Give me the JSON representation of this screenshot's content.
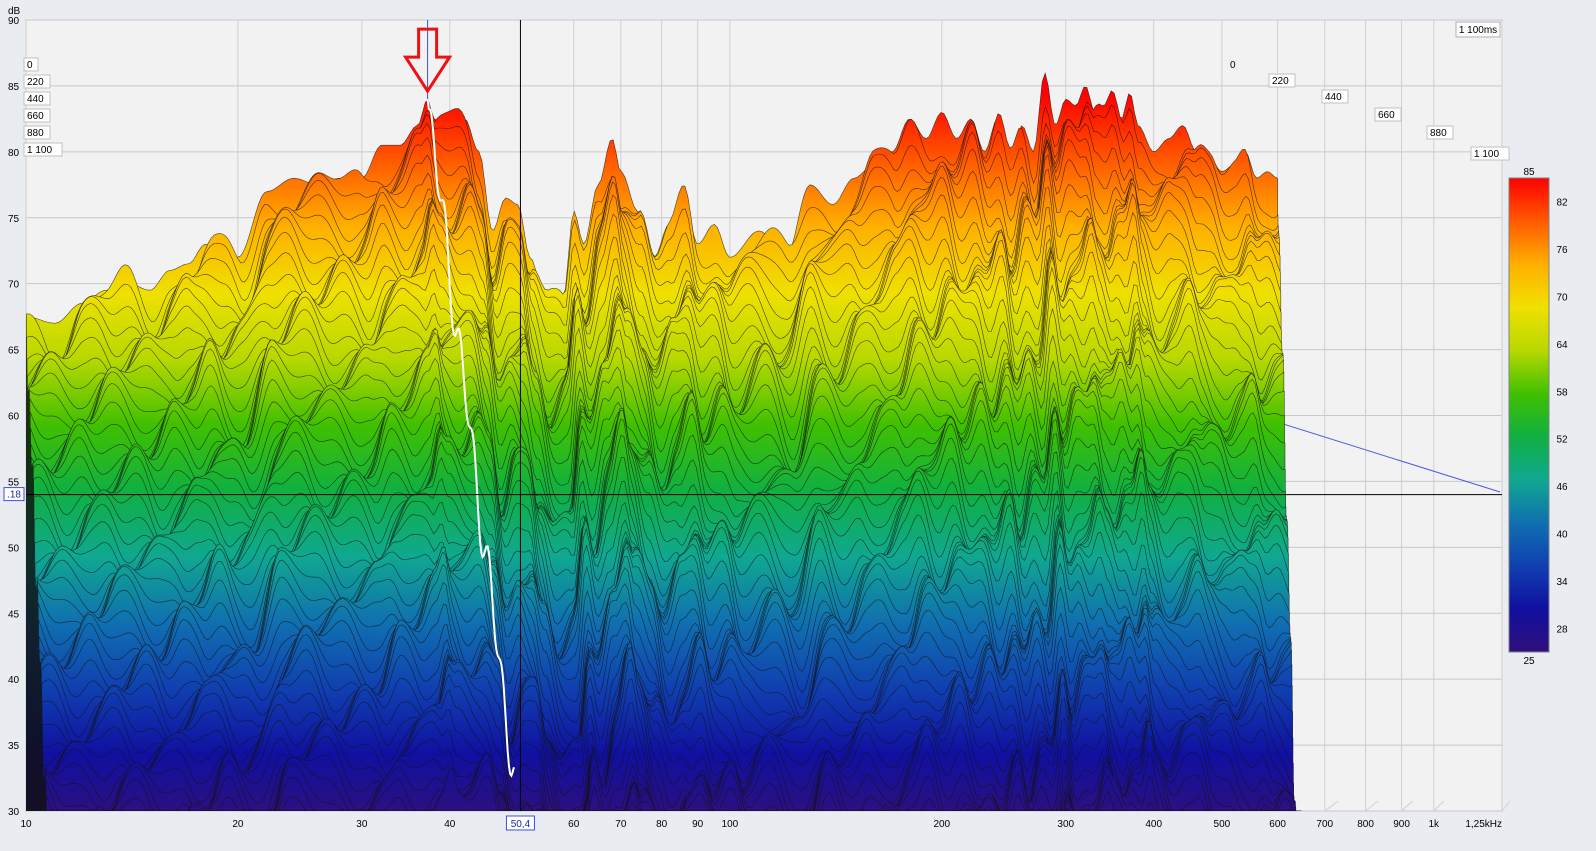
{
  "chart_data": {
    "type": "area",
    "title": "",
    "ylabel": "dB",
    "xlabel": "",
    "x_scale": "log",
    "xlim": [
      10,
      1250
    ],
    "ylim": [
      30,
      90
    ],
    "y_ticks": [
      30,
      35,
      40,
      45,
      50,
      55,
      60,
      65,
      70,
      75,
      80,
      85,
      90
    ],
    "x_ticks": [
      {
        "value": 10,
        "label": "10"
      },
      {
        "value": 20,
        "label": "20"
      },
      {
        "value": 30,
        "label": "30"
      },
      {
        "value": 40,
        "label": "40"
      },
      {
        "value": 60,
        "label": "60"
      },
      {
        "value": 70,
        "label": "70"
      },
      {
        "value": 80,
        "label": "80"
      },
      {
        "value": 90,
        "label": "90"
      },
      {
        "value": 100,
        "label": "100"
      },
      {
        "value": 200,
        "label": "200"
      },
      {
        "value": 300,
        "label": "300"
      },
      {
        "value": 400,
        "label": "400"
      },
      {
        "value": 500,
        "label": "500"
      },
      {
        "value": 600,
        "label": "600"
      },
      {
        "value": 700,
        "label": "700"
      },
      {
        "value": 800,
        "label": "800"
      },
      {
        "value": 900,
        "label": "900"
      },
      {
        "value": 1000,
        "label": "1k"
      },
      {
        "value": 1250,
        "label": "1,25kHz"
      }
    ],
    "time_axis_unit": "ms",
    "time_max_label": "1 100ms",
    "time_ticks_left": [
      "0",
      "220",
      "440",
      "660",
      "880",
      "1 100"
    ],
    "time_ticks_right": [
      "0",
      "220",
      "440",
      "660",
      "880",
      "1 100"
    ],
    "cursor": {
      "freq": 50.4,
      "freq_label": "50,4",
      "level": 54.0,
      "level_label": ".18"
    },
    "peak_marker": {
      "freq": 37.2,
      "level": 84.0
    },
    "colorbar": {
      "min_label": "25",
      "max_label": "85",
      "ticks": [
        "82",
        "76",
        "70",
        "64",
        "58",
        "52",
        "46",
        "40",
        "34",
        "28"
      ],
      "stops": [
        "#ff0000",
        "#ff5a00",
        "#ffb000",
        "#f0e000",
        "#b8d800",
        "#40c000",
        "#10b040",
        "#10a890",
        "#1070b0",
        "#1040b0",
        "#1010a0",
        "#30107a"
      ]
    },
    "series": [
      {
        "x": [
          10,
          11,
          12,
          13,
          14,
          15,
          16,
          17,
          18,
          19,
          20,
          22,
          24,
          26,
          28,
          30,
          32,
          34,
          36,
          37.2,
          38,
          40,
          42,
          44,
          46,
          48,
          50,
          52,
          55,
          58,
          60,
          62,
          65,
          68,
          70,
          74,
          78,
          82,
          86,
          90,
          95,
          100,
          110,
          120,
          130,
          140,
          150,
          160,
          170,
          180,
          190,
          200,
          210,
          220,
          230,
          240,
          250,
          260,
          270,
          280,
          290,
          300,
          310,
          320,
          330,
          340,
          350,
          360,
          370,
          380,
          400,
          420,
          440,
          460,
          480,
          500,
          520,
          540,
          560,
          580,
          600
        ],
        "values": [
          67.5,
          67.0,
          68.5,
          69.5,
          70.0,
          69.5,
          71.0,
          71.5,
          73.0,
          72.0,
          72.0,
          77.0,
          78.0,
          77.5,
          78.0,
          78.0,
          80.5,
          80.5,
          82.0,
          84.0,
          82.5,
          81.5,
          82.5,
          80.0,
          74.0,
          76.5,
          76.0,
          72.0,
          68.0,
          69.0,
          75.5,
          73.0,
          77.5,
          81.0,
          78.5,
          75.5,
          72.0,
          74.5,
          76.5,
          73.0,
          74.5,
          72.0,
          74.0,
          72.0,
          77.5,
          76.0,
          78.0,
          79.0,
          80.0,
          82.5,
          81.0,
          83.0,
          81.0,
          82.5,
          80.0,
          82.5,
          79.0,
          82.0,
          80.0,
          86.0,
          82.0,
          84.0,
          83.5,
          85.0,
          83.0,
          82.0,
          83.5,
          82.5,
          84.5,
          82.0,
          80.0,
          81.0,
          82.0,
          80.0,
          79.5,
          78.5,
          79.0,
          80.0,
          78.0,
          78.5,
          78.0
        ]
      }
    ]
  }
}
